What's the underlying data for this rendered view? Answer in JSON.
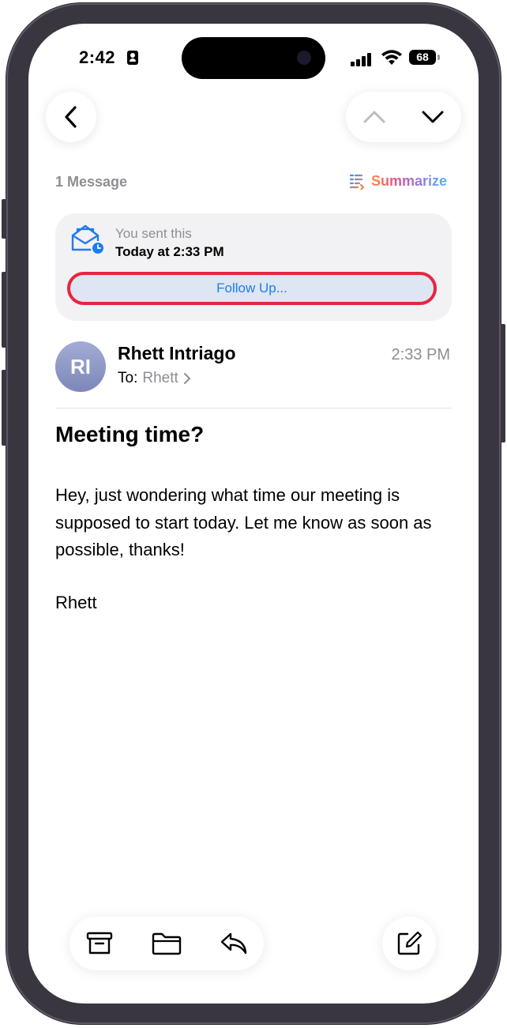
{
  "status_bar": {
    "time": "2:42",
    "battery": "68"
  },
  "thread": {
    "message_count": "1 Message",
    "summarize_label": "Summarize"
  },
  "sent_card": {
    "label": "You sent this",
    "time": "Today at 2:33 PM",
    "follow_up_label": "Follow Up..."
  },
  "email": {
    "avatar_initials": "RI",
    "sender": "Rhett Intriago",
    "to_label": "To:",
    "to_name": "Rhett",
    "time": "2:33 PM",
    "subject": "Meeting time?",
    "body": "Hey, just wondering what time our meeting is supposed to start today. Let me know as soon as possible, thanks!",
    "signature": "Rhett"
  },
  "colors": {
    "accent": "#1e7cf0",
    "highlight_border": "#e8253f",
    "secondary_text": "#8e8e93"
  },
  "icons": {
    "nav": [
      "back-chevron-icon",
      "up-chevron-icon",
      "down-chevron-icon"
    ],
    "toolbar": [
      "archive-icon",
      "folder-icon",
      "reply-icon",
      "compose-icon"
    ]
  }
}
